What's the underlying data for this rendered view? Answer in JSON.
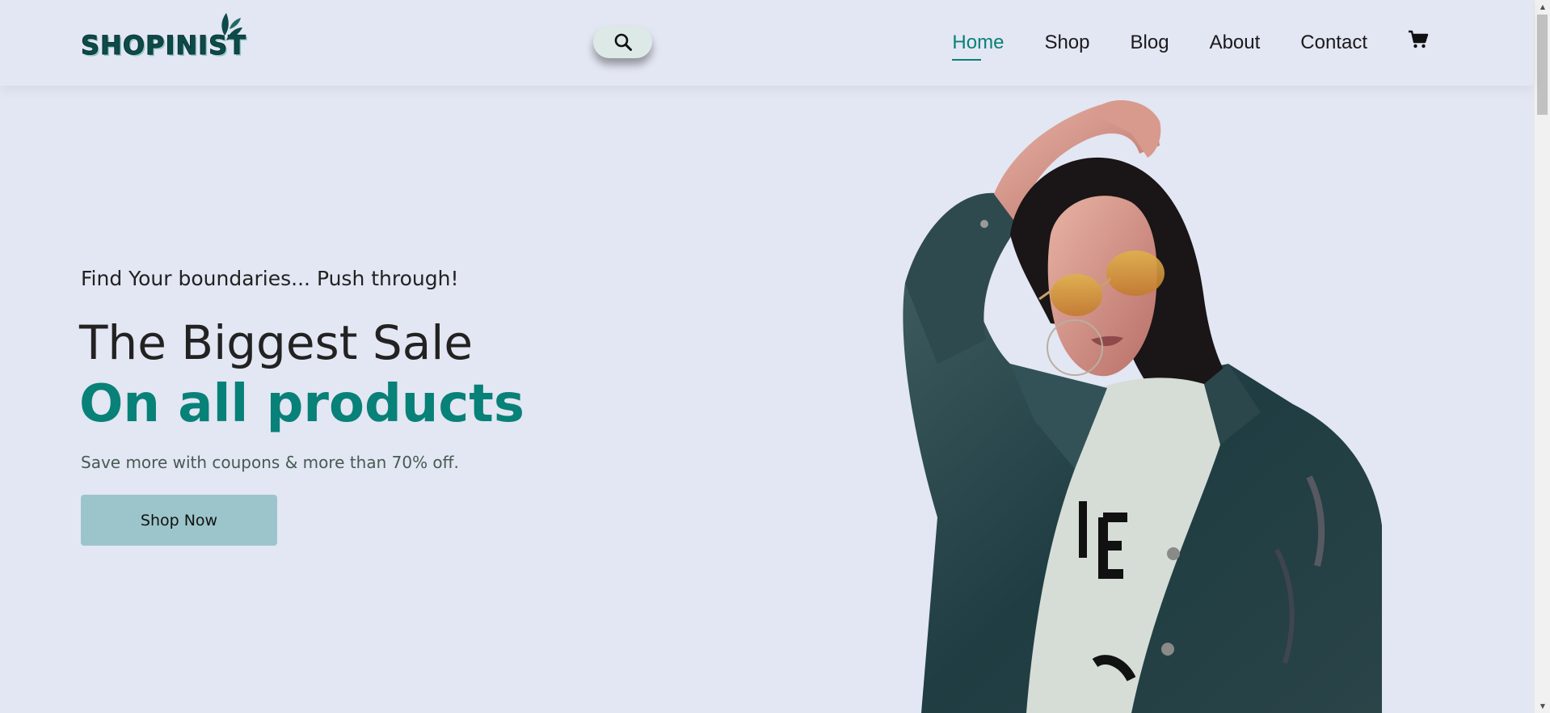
{
  "header": {
    "logo_text": "SHOPINIST",
    "nav": [
      {
        "label": "Home",
        "active": true
      },
      {
        "label": "Shop",
        "active": false
      },
      {
        "label": "Blog",
        "active": false
      },
      {
        "label": "About",
        "active": false
      },
      {
        "label": "Contact",
        "active": false
      }
    ],
    "icons": {
      "search": "search-icon",
      "cart": "cart-icon"
    }
  },
  "hero": {
    "tagline": "Find Your boundaries... Push through!",
    "headline": "The Biggest Sale",
    "headline_accent": "On all products",
    "subtext": "Save more with coupons & more than 70% off.",
    "cta_label": "Shop Now"
  },
  "colors": {
    "background": "#e3e6f3",
    "accent": "#088178",
    "button": "#9cc5cb",
    "logo": "#0d4a4a"
  }
}
